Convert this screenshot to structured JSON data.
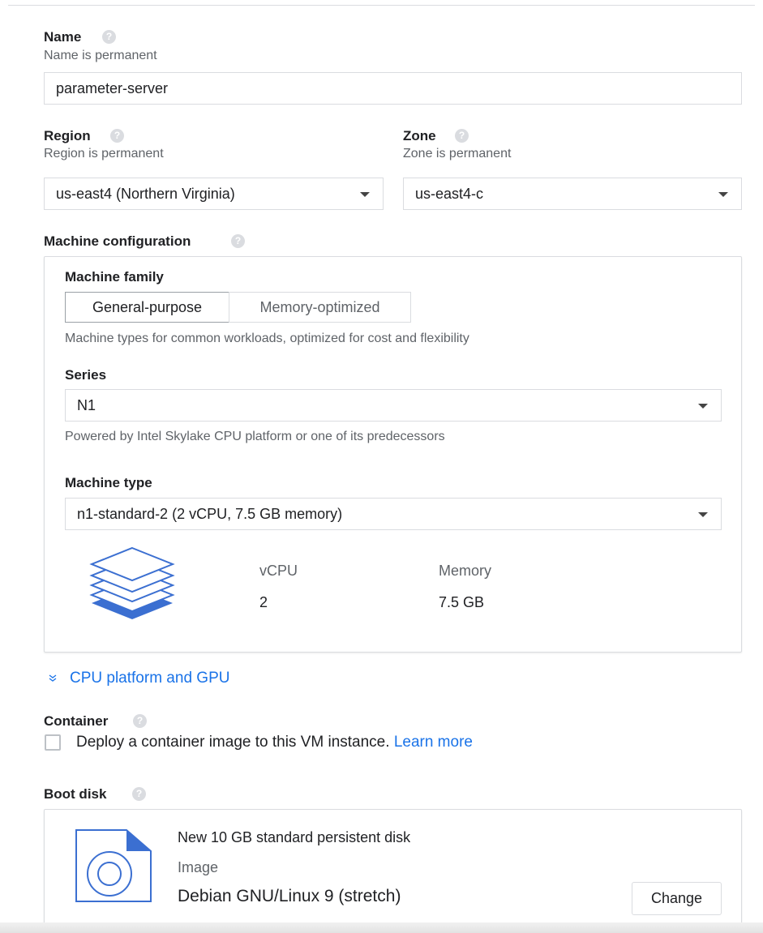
{
  "name": {
    "label": "Name",
    "help_icon": "help-icon",
    "subtitle": "Name is permanent",
    "value": "parameter-server"
  },
  "region": {
    "label": "Region",
    "subtitle": "Region is permanent",
    "value": "us-east4 (Northern Virginia)"
  },
  "zone": {
    "label": "Zone",
    "subtitle": "Zone is permanent",
    "value": "us-east4-c"
  },
  "machine_configuration": {
    "label": "Machine configuration",
    "family_label": "Machine family",
    "tabs": [
      {
        "label": "General-purpose",
        "selected": true
      },
      {
        "label": "Memory-optimized",
        "selected": false
      }
    ],
    "family_description": "Machine types for common workloads, optimized for cost and flexibility",
    "series_label": "Series",
    "series_value": "N1",
    "series_description": "Powered by Intel Skylake CPU platform or one of its predecessors",
    "machine_type_label": "Machine type",
    "machine_type_value": "n1-standard-2 (2 vCPU, 7.5 GB memory)",
    "specs": {
      "vcpu_label": "vCPU",
      "vcpu_value": "2",
      "memory_label": "Memory",
      "memory_value": "7.5 GB"
    }
  },
  "cpu_platform_link": "CPU platform and GPU",
  "container": {
    "label": "Container",
    "checkbox_text": "Deploy a container image to this VM instance.",
    "learn_more": "Learn more",
    "checked": false
  },
  "boot_disk": {
    "label": "Boot disk",
    "title": "New 10 GB standard persistent disk",
    "image_label": "Image",
    "image_value": "Debian GNU/Linux 9 (stretch)",
    "change_button": "Change"
  },
  "colors": {
    "accent": "#1a73e8",
    "icon_blue": "#3b6fd1",
    "border": "#dadce0"
  }
}
